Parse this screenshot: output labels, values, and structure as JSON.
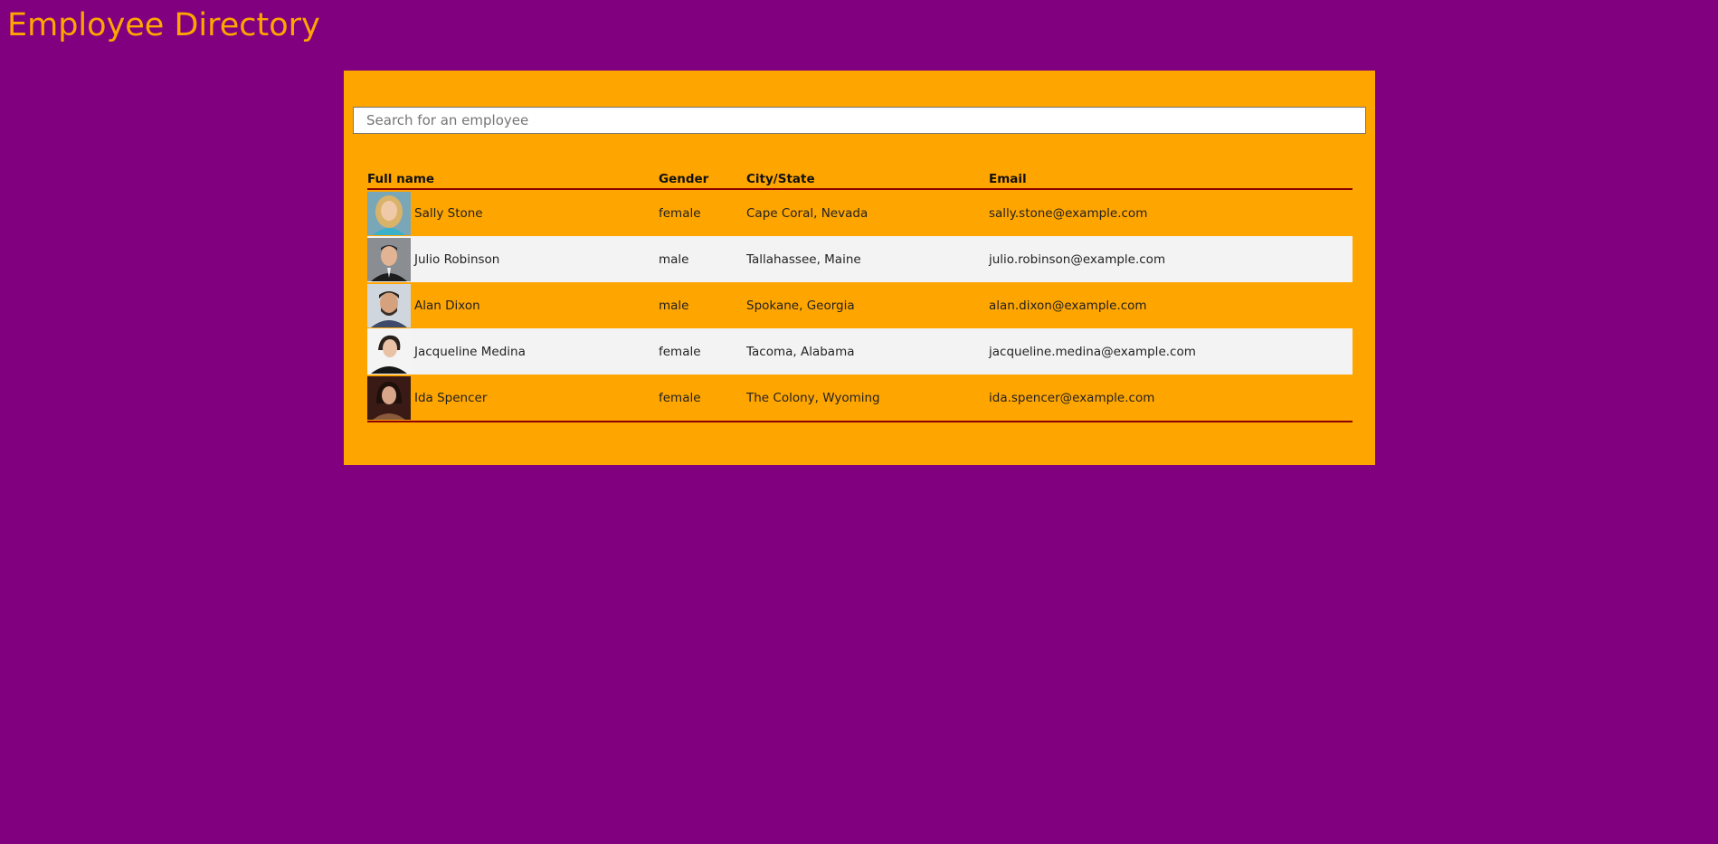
{
  "header": {
    "title": "Employee Directory"
  },
  "search": {
    "placeholder": "Search for an employee",
    "value": ""
  },
  "table": {
    "columns": {
      "name": "Full name",
      "gender": "Gender",
      "city": "City/State",
      "email": "Email"
    },
    "rows": [
      {
        "name": "Sally Stone",
        "gender": "female",
        "city": "Cape Coral, Nevada",
        "email": "sally.stone@example.com",
        "avatar_icon": "person-photo-icon"
      },
      {
        "name": "Julio Robinson",
        "gender": "male",
        "city": "Tallahassee, Maine",
        "email": "julio.robinson@example.com",
        "avatar_icon": "person-photo-icon"
      },
      {
        "name": "Alan Dixon",
        "gender": "male",
        "city": "Spokane, Georgia",
        "email": "alan.dixon@example.com",
        "avatar_icon": "person-photo-icon"
      },
      {
        "name": "Jacqueline Medina",
        "gender": "female",
        "city": "Tacoma, Alabama",
        "email": "jacqueline.medina@example.com",
        "avatar_icon": "person-photo-icon"
      },
      {
        "name": "Ida Spencer",
        "gender": "female",
        "city": "The Colony, Wyoming",
        "email": "ida.spencer@example.com",
        "avatar_icon": "person-photo-icon"
      }
    ]
  },
  "colors": {
    "background": "#800080",
    "panel": "#ffa500",
    "title": "#ffa500",
    "row_alt": "#f3f3f3",
    "table_rule": "#8b0000"
  }
}
